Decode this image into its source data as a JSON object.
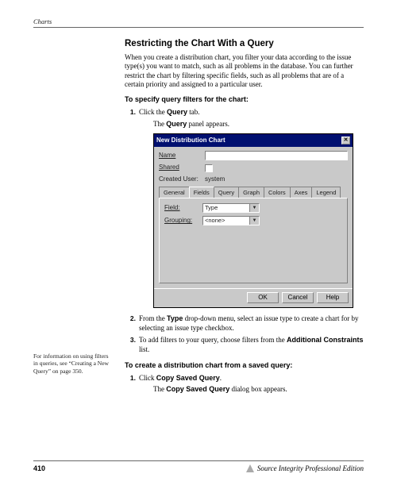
{
  "running_head": "Charts",
  "section_title": "Restricting the Chart With a Query",
  "intro": "When you create a distribution chart, you filter your data according to the issue type(s) you want to match, such as all problems in the database. You can further restrict the chart by filtering specific fields, such as all problems that are of a certain priority and assigned to a particular user.",
  "subhead1": "To specify query filters for the chart:",
  "step1_pre": "Click the ",
  "step1_bold": "Query",
  "step1_post": " tab.",
  "step1_result_pre": "The ",
  "step1_result_bold": "Query",
  "step1_result_post": " panel appears.",
  "dialog": {
    "title": "New Distribution Chart",
    "name_label": "Name",
    "shared_label": "Shared",
    "created_user_label": "Created User:",
    "created_user_value": "system",
    "tabs": [
      "General",
      "Fields",
      "Query",
      "Graph",
      "Colors",
      "Axes",
      "Legend"
    ],
    "active_tab": "Fields",
    "field_label": "Field:",
    "field_value": "Type",
    "grouping_label": "Grouping:",
    "grouping_value": "<none>",
    "ok": "OK",
    "cancel": "Cancel",
    "help": "Help"
  },
  "step2_pre": "From the ",
  "step2_bold": "Type",
  "step2_post": " drop-down menu, select an issue type to create a chart for by selecting an issue type checkbox.",
  "step3_pre": "To add filters to your query, choose filters from the ",
  "step3_bold": "Additional Constraints",
  "step3_post": " list.",
  "margin_note": "For information on using filters in queries, see “Creating a New Query” on page 350.",
  "subhead2": "To create a distribution chart from a saved query:",
  "step_b1_pre": "Click ",
  "step_b1_bold": "Copy Saved Query",
  "step_b1_post": ".",
  "step_b1_result_pre": "The ",
  "step_b1_result_bold": "Copy Saved Query",
  "step_b1_result_post": " dialog box appears.",
  "page_number": "410",
  "edition": "Source Integrity Professional Edition",
  "margin_note_top": 444
}
